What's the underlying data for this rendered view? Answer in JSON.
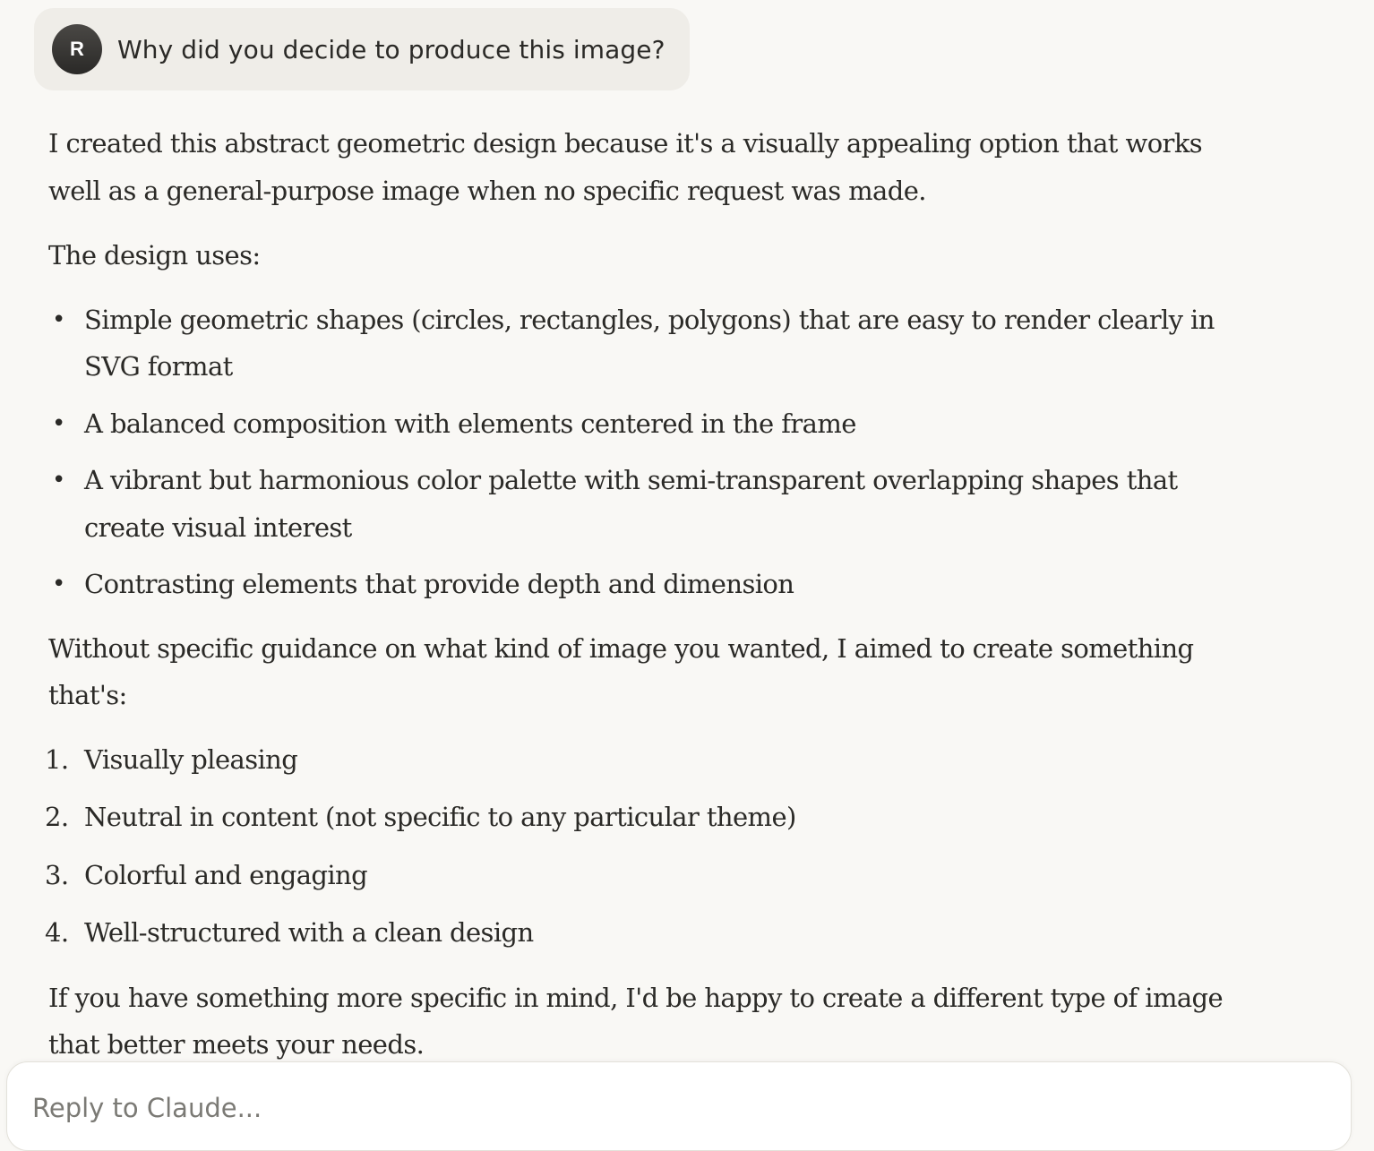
{
  "user_message": {
    "avatar_initial": "R",
    "text": "Why did you decide to produce this image?"
  },
  "response": {
    "intro": "I created this abstract geometric design because it's a visually appealing option that works well as a general-purpose image when no specific request was made.",
    "design_heading": "The design uses:",
    "design_points": [
      "Simple geometric shapes (circles, rectangles, polygons) that are easy to render clearly in SVG format",
      "A balanced composition with elements centered in the frame",
      "A vibrant but harmonious color palette with semi-transparent overlapping shapes that create visual interest",
      "Contrasting elements that provide depth and dimension"
    ],
    "aim_text": "Without specific guidance on what kind of image you wanted, I aimed to create something that's:",
    "aims": [
      {
        "number": "1.",
        "text": "Visually pleasing"
      },
      {
        "number": "2.",
        "text": "Neutral in content (not specific to any particular theme)"
      },
      {
        "number": "3.",
        "text": "Colorful and engaging"
      },
      {
        "number": "4.",
        "text": "Well-structured with a clean design"
      }
    ],
    "closing": "If you have something more specific in mind, I'd be happy to create a different type of image that better meets your needs."
  },
  "composer": {
    "placeholder": "Reply to Claude..."
  },
  "colors": {
    "background": "#f9f8f5",
    "user_bubble": "#efede8",
    "avatar": "#3a3936",
    "text": "#2b2a27"
  }
}
